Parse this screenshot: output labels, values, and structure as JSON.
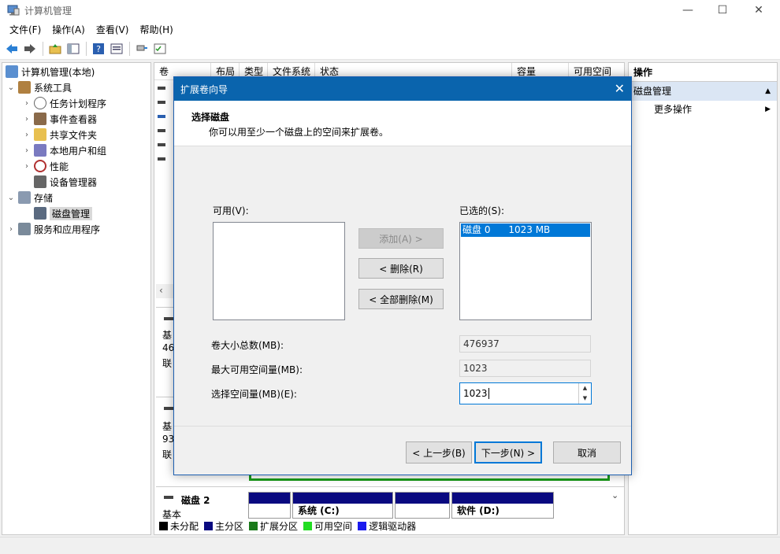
{
  "window": {
    "title": "计算机管理",
    "minimize": "—",
    "maximize": "☐",
    "close": "✕"
  },
  "menu": [
    "文件(F)",
    "操作(A)",
    "查看(V)",
    "帮助(H)"
  ],
  "tree": [
    {
      "label": "计算机管理(本地)",
      "chevron": ""
    },
    {
      "label": "系统工具",
      "chevron": "⌄"
    },
    {
      "label": "任务计划程序",
      "chevron": "›"
    },
    {
      "label": "事件查看器",
      "chevron": "›"
    },
    {
      "label": "共享文件夹",
      "chevron": "›"
    },
    {
      "label": "本地用户和组",
      "chevron": "›"
    },
    {
      "label": "性能",
      "chevron": "›"
    },
    {
      "label": "设备管理器",
      "chevron": ""
    },
    {
      "label": "存储",
      "chevron": "⌄"
    },
    {
      "label": "磁盘管理",
      "chevron": ""
    },
    {
      "label": "服务和应用程序",
      "chevron": "›"
    }
  ],
  "columns": [
    "卷",
    "布局",
    "类型",
    "文件系统",
    "状态",
    "容量",
    "可用空间"
  ],
  "disk_panels": [
    {
      "l1": "基",
      "l2": "46",
      "l3": "联"
    },
    {
      "l1": "基",
      "l2": "93",
      "l3": "联"
    }
  ],
  "disk2": {
    "name": "磁盘 2",
    "type": "基本",
    "partitions": [
      "系统 (C:)",
      "软件 (D:)"
    ]
  },
  "legend": [
    {
      "label": "未分配",
      "color": "#000000"
    },
    {
      "label": "主分区",
      "color": "#0a0a80"
    },
    {
      "label": "扩展分区",
      "color": "#1a7a1a"
    },
    {
      "label": "可用空间",
      "color": "#22dd22"
    },
    {
      "label": "逻辑驱动器",
      "color": "#1a1aee"
    }
  ],
  "actions": {
    "header": "操作",
    "section": "磁盘管理",
    "item": "更多操作"
  },
  "dialog": {
    "title": "扩展卷向导",
    "heading": "选择磁盘",
    "subheading": "你可以用至少一个磁盘上的空间来扩展卷。",
    "available_label": "可用(V):",
    "selected_label": "已选的(S):",
    "selected_items": [
      "磁盘 0      1023 MB"
    ],
    "add_button": "添加(A) >",
    "remove_button": "< 删除(R)",
    "remove_all_button": "< 全部删除(M)",
    "total_size_label": "卷大小总数(MB):",
    "total_size_value": "476937",
    "max_space_label": "最大可用空间量(MB):",
    "max_space_value": "1023",
    "select_space_label": "选择空间量(MB)(E):",
    "select_space_value": "1023",
    "back_button": "< 上一步(B)",
    "next_button": "下一步(N) >",
    "cancel_button": "取消"
  },
  "colors": {
    "accent": "#0078d7",
    "dialog_title_bg": "#0a64ad",
    "partition_bar": "#0a0a80"
  }
}
